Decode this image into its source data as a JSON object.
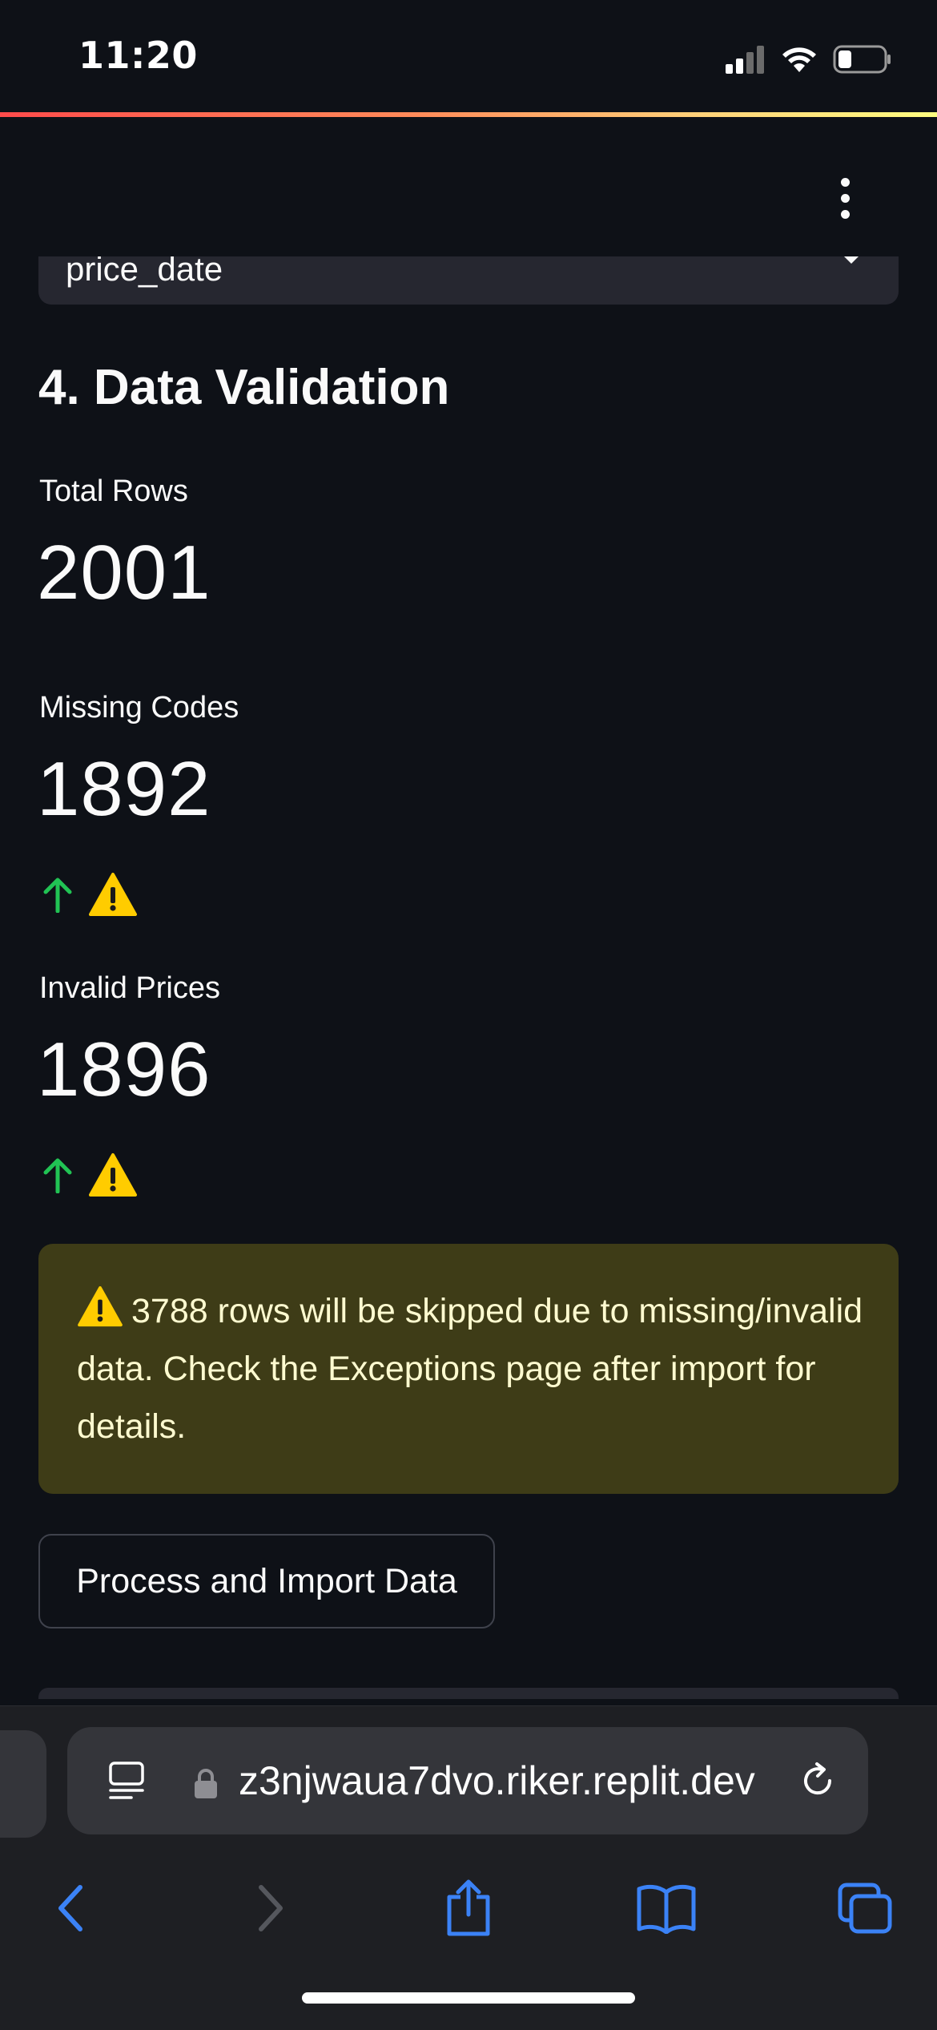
{
  "status_bar": {
    "time": "11:20",
    "battery_level": 0.3
  },
  "streamlit_menu": {
    "icon": "kebab-menu-icon"
  },
  "date_select": {
    "value": "price_date"
  },
  "section": {
    "title": "4. Data Validation"
  },
  "metrics": [
    {
      "label": "Total Rows",
      "value": "2001"
    },
    {
      "label": "Missing Codes",
      "value": "1892",
      "delta": "⚠️",
      "delta_direction": "up",
      "delta_color": "#21c354"
    },
    {
      "label": "Invalid Prices",
      "value": "1896",
      "delta": "⚠️",
      "delta_direction": "up",
      "delta_color": "#21c354"
    }
  ],
  "warning": {
    "icon": "⚠️",
    "text": "3788 rows will be skipped due to missing/invalid data. Check the Exceptions page after import for details.",
    "background": "#3e3c17",
    "text_color": "#fffbd0"
  },
  "import_button": {
    "label": "Process and Import Data"
  },
  "browser": {
    "url": "z3njwaua7dvo.riker.replit.dev",
    "accent": "#3b82f6",
    "nav": [
      "back-icon",
      "forward-icon",
      "share-icon",
      "bookmarks-icon",
      "tabs-icon"
    ]
  },
  "colors": {
    "background": "#0e1117",
    "surface": "#262730",
    "accent_gradient": [
      "#ff4b4b",
      "#fffd80"
    ]
  }
}
